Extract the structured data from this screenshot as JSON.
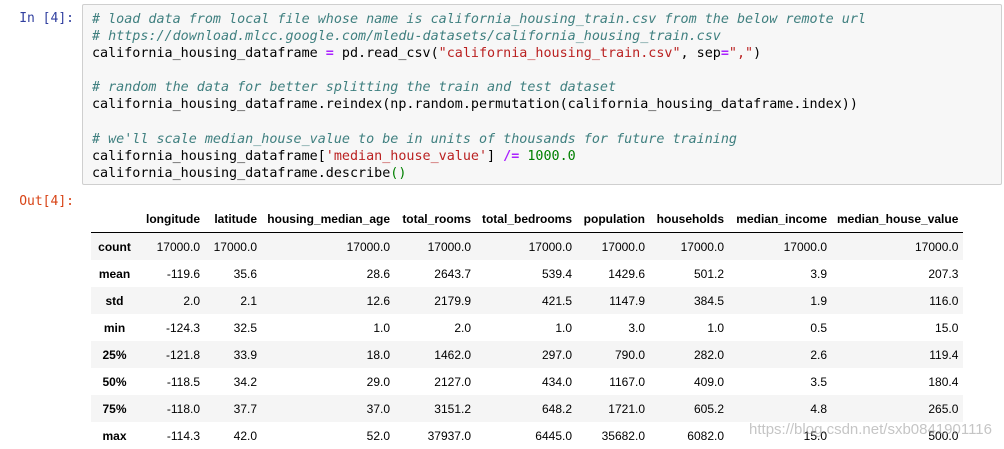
{
  "cell": {
    "in_prompt": "In [4]:",
    "out_prompt": "Out[4]:",
    "code": {
      "line1_comment": "# load data from local file whose name is california_housing_train.csv from the below remote url",
      "line2_comment": "# https://download.mlcc.google.com/mledu-datasets/california_housing_train.csv",
      "line3_a": "california_housing_dataframe ",
      "line3_op": "=",
      "line3_b": " pd.read_csv(",
      "line3_str1": "\"california_housing_train.csv\"",
      "line3_c": ", sep",
      "line3_op2": "=",
      "line3_str2": "\",\"",
      "line3_d": ")",
      "line5_comment": "# random the data for better splitting the train and test dataset",
      "line6": "california_housing_dataframe.reindex(np.random.permutation(california_housing_dataframe.index))",
      "line8_comment": "# we'll scale median_house_value to be in units of thousands for future training",
      "line9_a": "california_housing_dataframe[",
      "line9_str": "'median_house_value'",
      "line9_b": "] ",
      "line9_op": "/=",
      "line9_c": " ",
      "line9_num": "1000.0",
      "line10_a": "california_housing_dataframe.describe",
      "line10_par": "()"
    }
  },
  "table": {
    "columns": [
      "",
      "longitude",
      "latitude",
      "housing_median_age",
      "total_rooms",
      "total_bedrooms",
      "population",
      "households",
      "median_income",
      "median_house_value"
    ],
    "rows": [
      {
        "index": "count",
        "values": [
          "17000.0",
          "17000.0",
          "17000.0",
          "17000.0",
          "17000.0",
          "17000.0",
          "17000.0",
          "17000.0",
          "17000.0"
        ]
      },
      {
        "index": "mean",
        "values": [
          "-119.6",
          "35.6",
          "28.6",
          "2643.7",
          "539.4",
          "1429.6",
          "501.2",
          "3.9",
          "207.3"
        ]
      },
      {
        "index": "std",
        "values": [
          "2.0",
          "2.1",
          "12.6",
          "2179.9",
          "421.5",
          "1147.9",
          "384.5",
          "1.9",
          "116.0"
        ]
      },
      {
        "index": "min",
        "values": [
          "-124.3",
          "32.5",
          "1.0",
          "2.0",
          "1.0",
          "3.0",
          "1.0",
          "0.5",
          "15.0"
        ]
      },
      {
        "index": "25%",
        "values": [
          "-121.8",
          "33.9",
          "18.0",
          "1462.0",
          "297.0",
          "790.0",
          "282.0",
          "2.6",
          "119.4"
        ]
      },
      {
        "index": "50%",
        "values": [
          "-118.5",
          "34.2",
          "29.0",
          "2127.0",
          "434.0",
          "1167.0",
          "409.0",
          "3.5",
          "180.4"
        ]
      },
      {
        "index": "75%",
        "values": [
          "-118.0",
          "37.7",
          "37.0",
          "3151.2",
          "648.2",
          "1721.0",
          "605.2",
          "4.8",
          "265.0"
        ]
      },
      {
        "index": "max",
        "values": [
          "-114.3",
          "42.0",
          "52.0",
          "37937.0",
          "6445.0",
          "35682.0",
          "6082.0",
          "15.0",
          "500.0"
        ]
      }
    ]
  },
  "watermark": "https://blog.csdn.net/sxb0841901116",
  "colors": {
    "in_prompt": "#303f9f",
    "out_prompt": "#d84315",
    "comment": "#408080",
    "string": "#ba2121",
    "operator": "#aa22ff",
    "number": "#008000"
  }
}
